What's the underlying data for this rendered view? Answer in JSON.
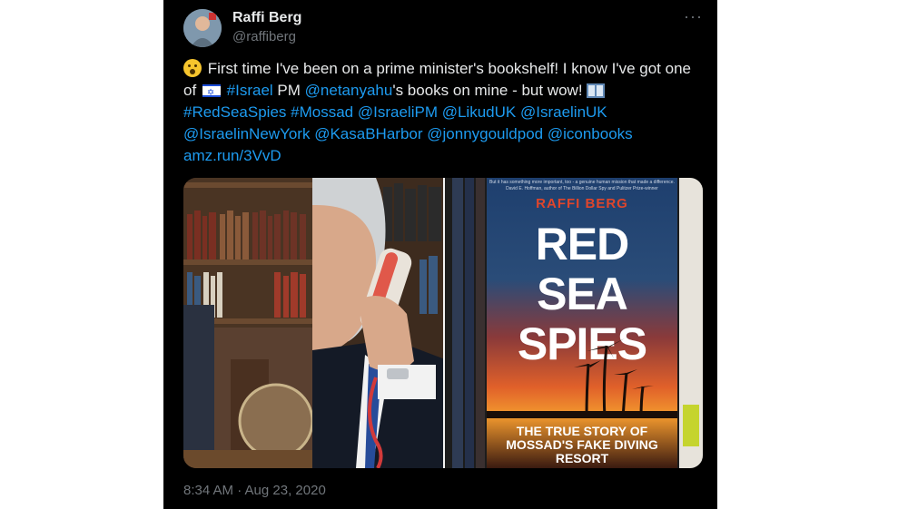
{
  "tweet": {
    "author_name": "Raffi Berg",
    "author_handle": "@raffiberg",
    "more_label": "···",
    "text_parts": {
      "p1": "First time I've been on a prime minister's bookshelf! I know I've got one of",
      "israel_tag": "#Israel",
      "p2": "PM",
      "netanyahu": "@netanyahu",
      "p3": "'s books on mine - but wow!",
      "redseaspies": "#RedSeaSpies",
      "mossad": "#Mossad",
      "israelipm": "@IsraeliPM",
      "likuduk": "@LikudUK",
      "israelinuk": "@IsraelinUK",
      "israelinnewyork": "@IsraelinNewYork",
      "kasab": "@KasaBHarbor",
      "jonny": "@jonnygouldpod",
      "iconbooks": "@iconbooks",
      "link": "amz.run/3VvD"
    },
    "timestamp": "8:34 AM · Aug 23, 2020"
  },
  "media": {
    "book": {
      "quote": "But it has something more important, too - a genuine human mission that made a difference. David E. Hoffman, author of The Billion Dollar Spy and Pulitzer Prize-winner",
      "author": "RAFFI BERG",
      "title_line1": "RED",
      "title_line2": "SEA",
      "title_line3": "SPIES",
      "subtitle": "THE TRUE STORY OF MOSSAD'S FAKE DIVING RESORT"
    }
  },
  "icons": [
    "avatar",
    "astonished-face-emoji",
    "israel-flag-emoji",
    "open-book-emoji",
    "more-icon"
  ]
}
